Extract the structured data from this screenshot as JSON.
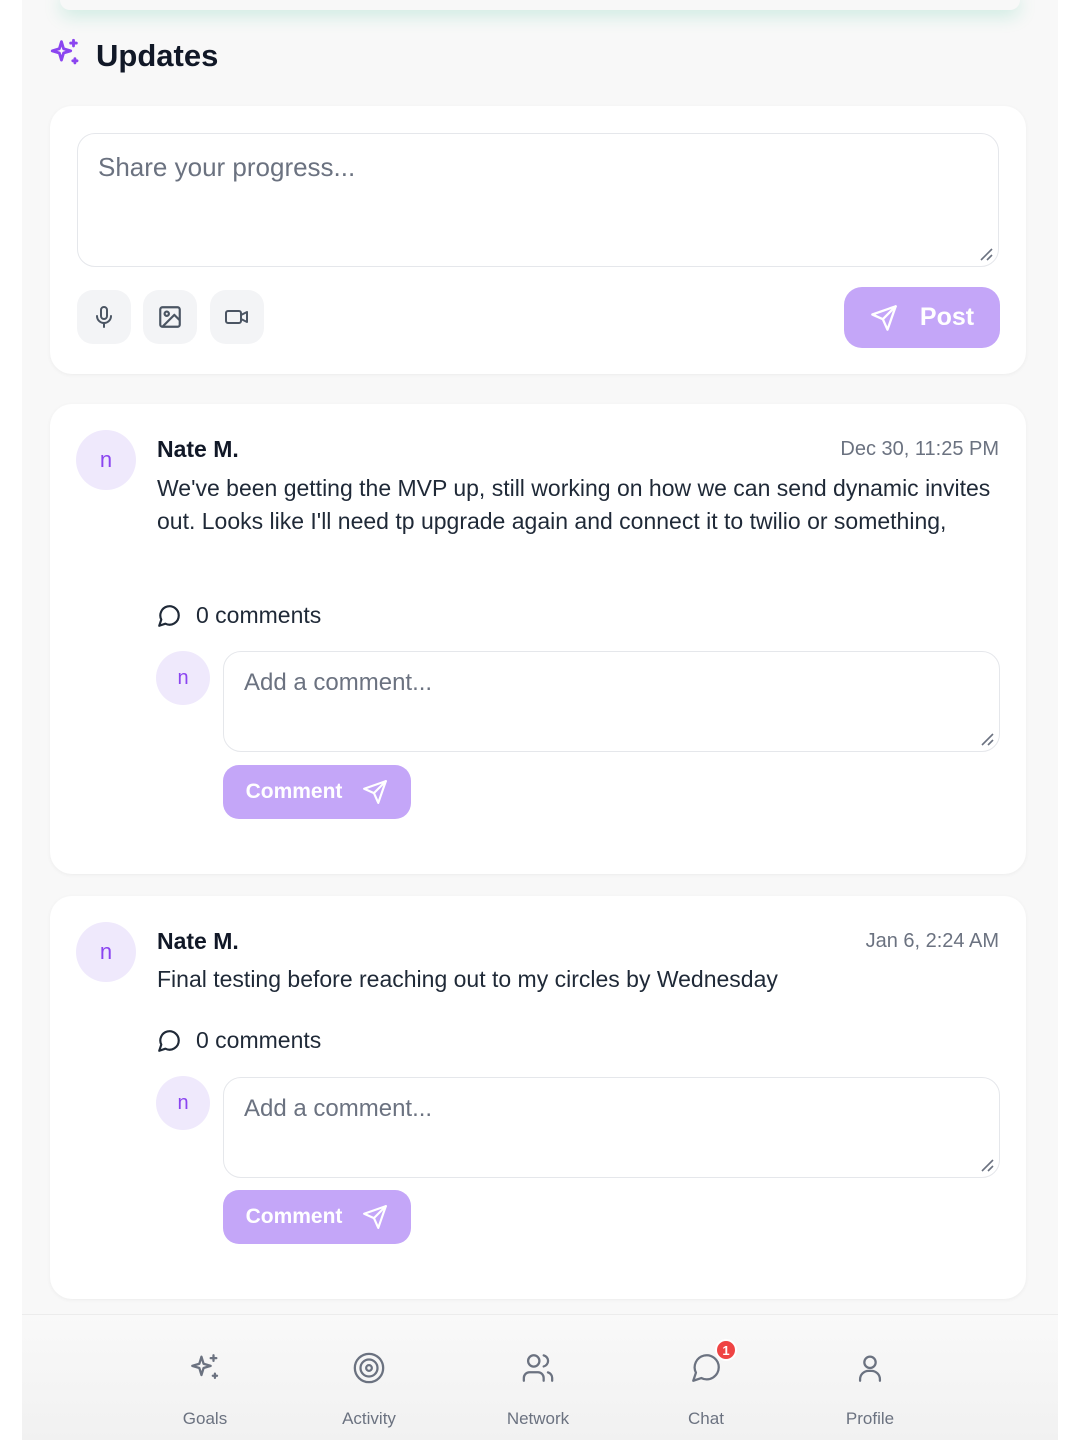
{
  "header": {
    "title": "Updates",
    "icon": "sparkles-icon"
  },
  "composer": {
    "placeholder": "Share your progress...",
    "post_label": "Post",
    "media_buttons": [
      "microphone-icon",
      "image-icon",
      "video-icon"
    ]
  },
  "posts": [
    {
      "avatar": "n",
      "author": "Nate M.",
      "timestamp": "Dec 30, 11:25 PM",
      "body": "We've been getting the MVP up, still working on how we can send dynamic invites out. Looks like I'll need tp upgrade again and connect it to twilio or something,",
      "comments": "0 comments",
      "comment_avatar": "n",
      "comment_placeholder": "Add a comment...",
      "comment_label": "Comment"
    },
    {
      "avatar": "n",
      "author": "Nate M.",
      "timestamp": "Jan 6, 2:24 AM",
      "body": "Final testing before reaching out to my circles by Wednesday",
      "comments": "0 comments",
      "comment_avatar": "n",
      "comment_placeholder": "Add a comment...",
      "comment_label": "Comment"
    }
  ],
  "nav": {
    "items": [
      {
        "label": "Goals",
        "icon": "sparkles-icon"
      },
      {
        "label": "Activity",
        "icon": "target-icon"
      },
      {
        "label": "Network",
        "icon": "users-icon"
      },
      {
        "label": "Chat",
        "icon": "chat-icon",
        "badge": "1"
      },
      {
        "label": "Profile",
        "icon": "user-icon"
      }
    ]
  },
  "colors": {
    "accent": "#8b45f0",
    "button": "#c4a6f8",
    "badge": "#ef4444"
  }
}
